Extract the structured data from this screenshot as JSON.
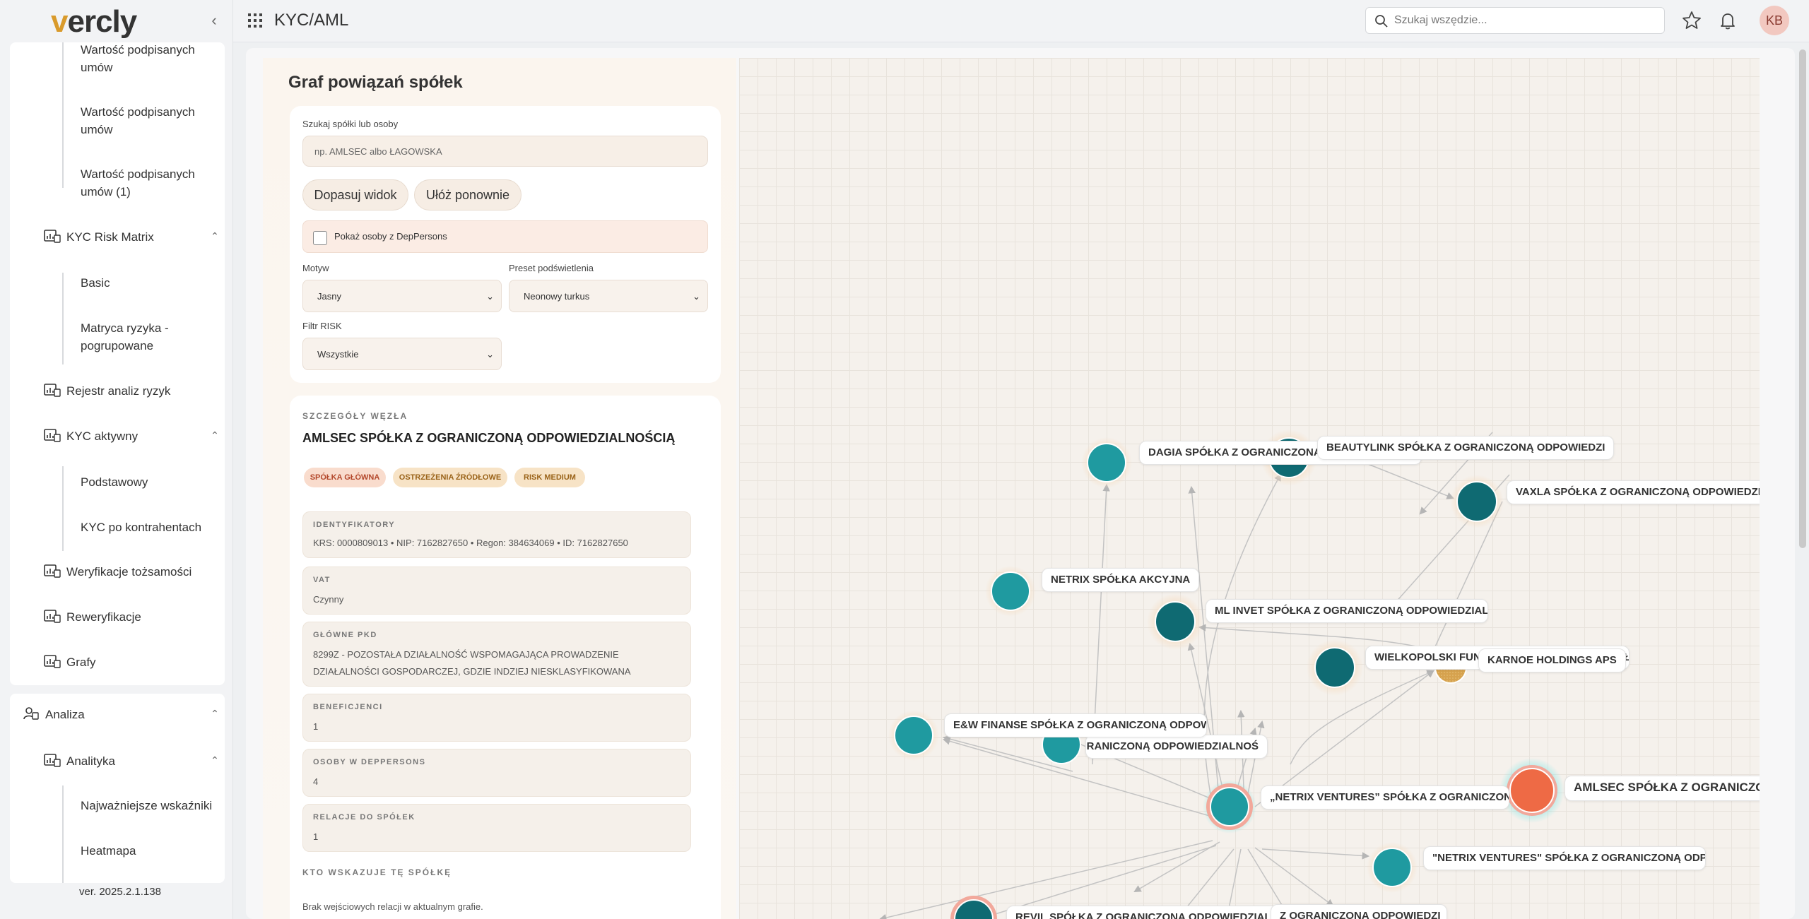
{
  "app": {
    "logo_prefix": "v",
    "logo_rest": "ercly",
    "version": "ver. 2025.2.1.138",
    "module_title": "KYC/AML"
  },
  "topbar": {
    "search_placeholder": "Szukaj wszędzie...",
    "avatar_initials": "KB"
  },
  "sidebar": {
    "sub_top": [
      "Wartość podpisanych umów",
      "Wartość podpisanych umów",
      "Wartość podpisanych umów (1)"
    ],
    "kyc_risk_matrix": "KYC Risk Matrix",
    "risk_children": [
      "Basic",
      "Matryca ryzyka - pogrupowane"
    ],
    "rejestr": "Rejestr analiz ryzyk",
    "kyc_aktywny": "KYC aktywny",
    "aktywny_children": [
      "Podstawowy",
      "KYC po kontrahentach"
    ],
    "weryfikacje": "Weryfikacje tożsamości",
    "reweryfikacje": "Reweryfikacje",
    "grafy": "Grafy",
    "analiza": "Analiza",
    "analityka": "Analityka",
    "analityka_children": [
      "Najważniejsze wskaźniki",
      "Heatmapa"
    ]
  },
  "panel": {
    "title": "Graf powiązań spółek",
    "search_label": "Szukaj spółki lub osoby",
    "search_placeholder": "np. AMLSEC albo ŁAGOWSKA",
    "btn_fit": "Dopasuj widok",
    "btn_relayout": "Ułóż ponownie",
    "checkbox_label": "Pokaż osoby z DepPersons",
    "theme_label": "Motyw",
    "theme_value": "Jasny",
    "preset_label": "Preset podświetlenia",
    "preset_value": "Neonowy turkus",
    "risk_label": "Filtr RISK",
    "risk_value": "Wszystkie"
  },
  "details": {
    "header": "SZCZEGÓŁY WĘZŁA",
    "name": "AMLSEC SPÓŁKA Z OGRANICZONĄ ODPOWIEDZIALNOŚCIĄ",
    "badges": [
      "SPÓŁKA GŁÓWNA",
      "OSTRZEŻENIA ŹRÓDŁOWE",
      "RISK MEDIUM"
    ],
    "ident_title": "IDENTYFIKATORY",
    "ident_value": "KRS: 0000809013 • NIP: 7162827650 • Regon: 384634069 • ID: 7162827650",
    "vat_title": "VAT",
    "vat_value": "Czynny",
    "pkd_title": "GŁÓWNE PKD",
    "pkd_value": "8299Z - POZOSTAŁA DZIAŁALNOŚĆ WSPOMAGAJĄCA PROWADZENIE DZIAŁALNOŚCI GOSPODARCZEJ, GDZIE INDZIEJ NIESKLASYFIKOWANA",
    "benef_title": "BENEFICJENCI",
    "benef_value": "1",
    "dep_title": "OSOBY W DEPPERSONS",
    "dep_value": "4",
    "rel_title": "RELACJE DO SPÓŁEK",
    "rel_value": "1",
    "incoming_header": "KTO WSKAZUJE TĘ SPÓŁKĘ",
    "incoming_value": "Brak wejściowych relacji w aktualnym grafie."
  },
  "graph": {
    "labels": {
      "dagia": "DAGIA SPÓŁKA Z OGRANICZONĄ ODPOWIEDZIALNOŚCIĄ",
      "beautylink": "BEAUTYLINK SPÓŁKA Z OGRANICZONĄ ODPOWIEDZI",
      "vaxla": "VAXLA SPÓŁKA Z OGRANICZONĄ ODPOWIEDZIAL",
      "netrix_sa": "NETRIX SPÓŁKA AKCYJNA",
      "ml_invet": "ML INVET SPÓŁKA Z OGRANICZONĄ ODPOWIEDZIAL",
      "wielkopolski": "WIELKOPOLSKI FUNDUSZ INWESTYCYJNY DZIAŁALNOŚĆ",
      "karnoe": "KARNOE HOLDINGS APS",
      "ew_finanse": "E&W FINANSE SPÓŁKA Z OGRANICZONĄ ODPOWIEDZ",
      "mid": "SPÓŁKA Z OGRANICZONĄ ODPOWIEDZIALNOŚ",
      "netrix_ventures_a": "„NETRIX VENTURES” SPÓŁKA Z OGRANICZONĄ",
      "amlsec": "AMLSEC SPÓŁKA Z OGRANICZONĄ",
      "netrix_ventures_b": "\"NETRIX VENTURES\" SPÓŁKA Z OGRANICZONĄ ODPO",
      "bottom_a": "REVIL SPÓŁKA Z OGRANICZONĄ ODPOWIEDZIALNOŚ",
      "bottom_b": "Z OGRANICZONĄ ODPOWIEDZI"
    },
    "colors": {
      "teal": "#1f9aa0",
      "dark_teal": "#0f6a72",
      "orange": "#ee6a45",
      "gold": "#d6a24e"
    }
  }
}
